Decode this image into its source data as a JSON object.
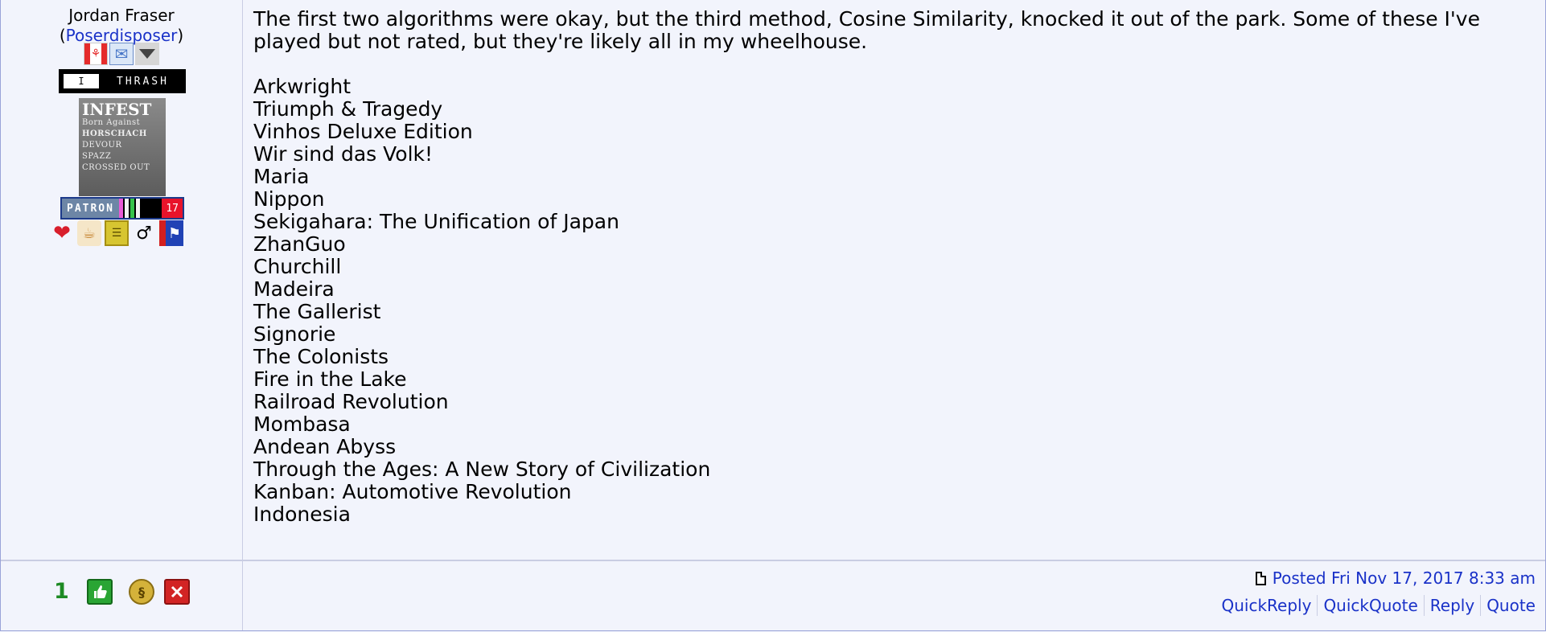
{
  "user": {
    "name": "Jordan Fraser",
    "handle_open": "(",
    "handle": "Poserdisposer",
    "handle_close": ")",
    "flag_icon": "canada-flag-icon",
    "thrash_box": "I",
    "thrash_label": "THRASH",
    "poster_lines": [
      "INFEST",
      "Born Against",
      "HORSCHACH",
      "DEVOUR",
      "SPAZZ",
      "CROSSED OUT"
    ],
    "patron_label": "PATRON",
    "patron_number": "17",
    "patron_bar_colors": [
      "#e95bd6",
      "#f2f2f2",
      "#36c24a",
      "#f2f2f2"
    ]
  },
  "post": {
    "intro": "The first two algorithms were okay, but the third method, Cosine Similarity, knocked it out of the park. Some of these I've played but not rated, but they're likely all in my wheelhouse.",
    "games": [
      "Arkwright",
      "Triumph & Tragedy",
      "Vinhos Deluxe Edition",
      "Wir sind das Volk!",
      "Maria",
      "Nippon",
      "Sekigahara: The Unification of Japan",
      "ZhanGuo",
      "Churchill",
      "Madeira",
      "The Gallerist",
      "Signorie",
      "The Colonists",
      "Fire in the Lake",
      "Railroad Revolution",
      "Mombasa",
      "Andean Abyss",
      "Through the Ages: A New Story of Civilization",
      "Kanban: Automotive Revolution",
      "Indonesia"
    ]
  },
  "footer": {
    "thumb_count": "1",
    "posted": "Posted Fri Nov 17, 2017 8:33 am",
    "actions": [
      "QuickReply",
      "QuickQuote",
      "Reply",
      "Quote"
    ]
  },
  "colors": {
    "link": "#1a32c8",
    "background": "#f2f4fc",
    "thumb_green": "#2aa534",
    "delete_red": "#d22424"
  }
}
